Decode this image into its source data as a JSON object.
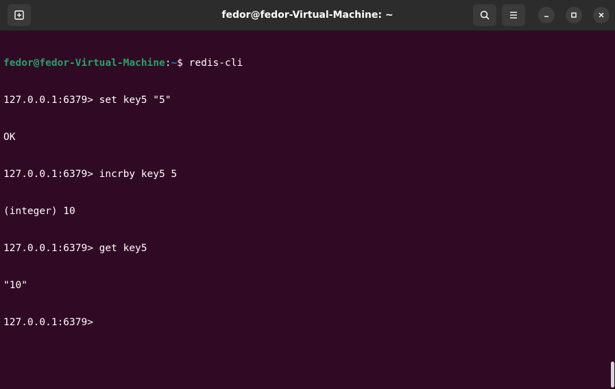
{
  "window": {
    "title": "fedor@fedor-Virtual-Machine: ~"
  },
  "titlebar": {
    "new_tab_icon": "new-tab-icon",
    "search_icon": "search-icon",
    "menu_icon": "hamburger-menu-icon",
    "minimize_icon": "minimize-icon",
    "maximize_icon": "maximize-icon",
    "close_icon": "close-icon"
  },
  "terminal": {
    "prompt": {
      "user_host": "fedor@fedor-Virtual-Machine",
      "separator": ":",
      "path": "~",
      "symbol": "$ ",
      "command": "redis-cli"
    },
    "lines": [
      "127.0.0.1:6379> set key5 \"5\"",
      "OK",
      "127.0.0.1:6379> incrby key5 5",
      "(integer) 10",
      "127.0.0.1:6379> get key5",
      "\"10\"",
      "127.0.0.1:6379> "
    ]
  },
  "colors": {
    "terminal_bg": "#300a24",
    "titlebar_bg": "#2c2c2c",
    "prompt_user": "#26a269",
    "prompt_path": "#2a7bde",
    "text": "#ffffff"
  }
}
